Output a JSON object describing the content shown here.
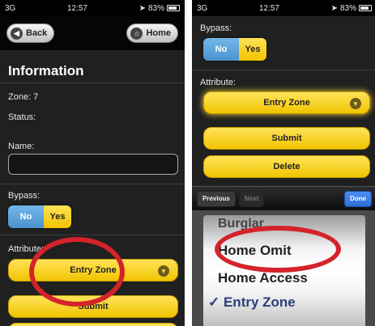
{
  "left": {
    "status": {
      "carrier": "3G",
      "time": "12:57",
      "battery": "83%"
    },
    "nav": {
      "back_label": "Back",
      "home_label": "Home"
    },
    "title": "Information",
    "zone": "Zone: 7",
    "status_label": "Status:",
    "name_label": "Name:",
    "name_value": "",
    "bypass_label": "Bypass:",
    "bypass_options": [
      "No",
      "Yes"
    ],
    "bypass_selected": "No",
    "attribute_label": "Attribute:",
    "attribute_value": "Entry Zone",
    "submit_label": "Submit"
  },
  "right": {
    "status": {
      "carrier": "3G",
      "time": "12:57",
      "battery": "83%"
    },
    "bypass_label": "Bypass:",
    "bypass_options": [
      "No",
      "Yes"
    ],
    "attribute_label": "Attribute:",
    "attribute_value": "Entry Zone",
    "submit_label": "Submit",
    "delete_label": "Delete",
    "toolbar": {
      "previous_label": "Previous",
      "next_label": "Next",
      "done_label": "Done"
    },
    "picker_items": [
      "Burglar",
      "Home Omit",
      "Home Access",
      "✓ Entry Zone"
    ]
  },
  "colors": {
    "accent_yellow": "#f5c800",
    "bypass_blue": "#4b93cf",
    "highlight_red": "#d4232b",
    "done_blue": "#2f6fd6"
  }
}
